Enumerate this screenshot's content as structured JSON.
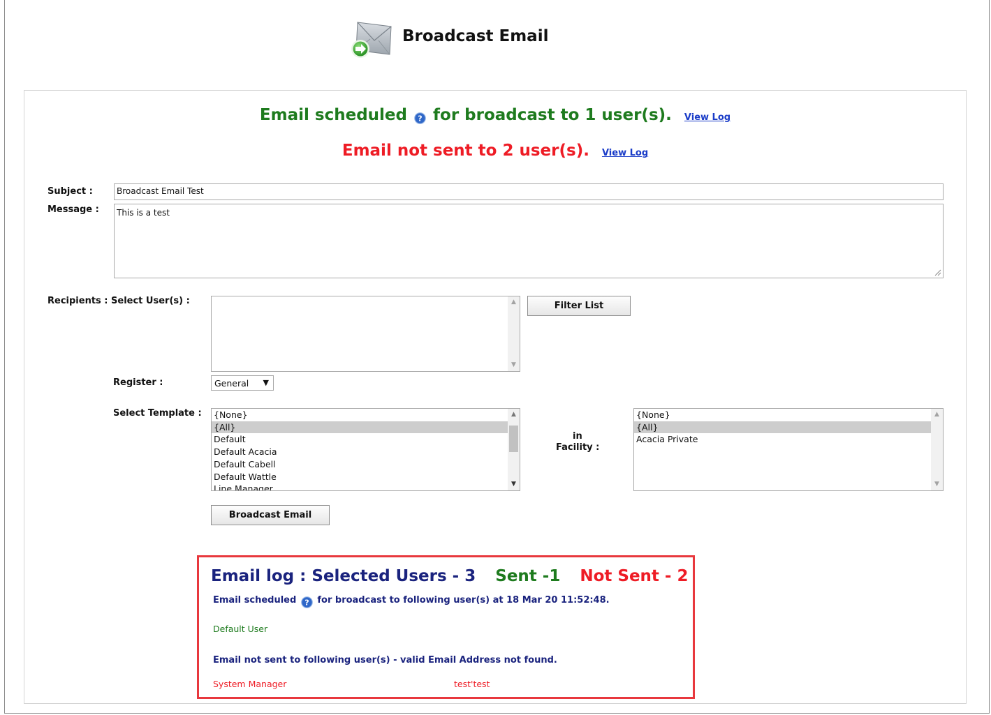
{
  "page": {
    "title": "Broadcast Email"
  },
  "status": {
    "scheduled_before": "Email scheduled",
    "scheduled_after": "for broadcast to 1 user(s).",
    "not_sent": "Email not sent to 2 user(s).",
    "view_log": "View Log"
  },
  "form": {
    "subject_label": "Subject :",
    "subject_value": "Broadcast Email Test",
    "message_label": "Message :",
    "message_value": "This is a test",
    "recipients_label": "Recipients : Select User(s) :",
    "filter_button": "Filter List",
    "register_label": "Register :",
    "register_value": "General",
    "template_label": "Select Template :",
    "templates": [
      "{None}",
      "{All}",
      "Default",
      "Default Acacia",
      "Default Cabell",
      "Default Wattle",
      "Line Manager"
    ],
    "templates_selected": "{All}",
    "in_label": "in",
    "facility_label": "Facility :",
    "facilities": [
      "{None}",
      "{All}",
      "Acacia Private"
    ],
    "facilities_selected": "{All}",
    "broadcast_button": "Broadcast Email"
  },
  "log": {
    "heading": "Email log : Selected Users - 3",
    "sent": "Sent -1",
    "not_sent": "Not Sent - 2",
    "scheduled_before": "Email scheduled",
    "scheduled_after": "for broadcast to following user(s) at 18 Mar 20 11:52:48.",
    "scheduled_users": [
      "Default User"
    ],
    "not_sent_line": "Email not sent to following user(s) - valid Email Address not found.",
    "not_sent_users": [
      "System Manager",
      "test'test"
    ]
  },
  "colors": {
    "success": "#1e7b1e",
    "error": "#ee1c25",
    "heading_navy": "#1a237e",
    "link": "#1a3cc8",
    "log_border": "#e8383d"
  },
  "icons": {
    "title": "broadcast-email-icon",
    "help": "help-icon",
    "scroll_up": "scroll-up-arrow-icon",
    "scroll_down": "scroll-down-arrow-icon",
    "dropdown": "dropdown-caret-icon"
  }
}
